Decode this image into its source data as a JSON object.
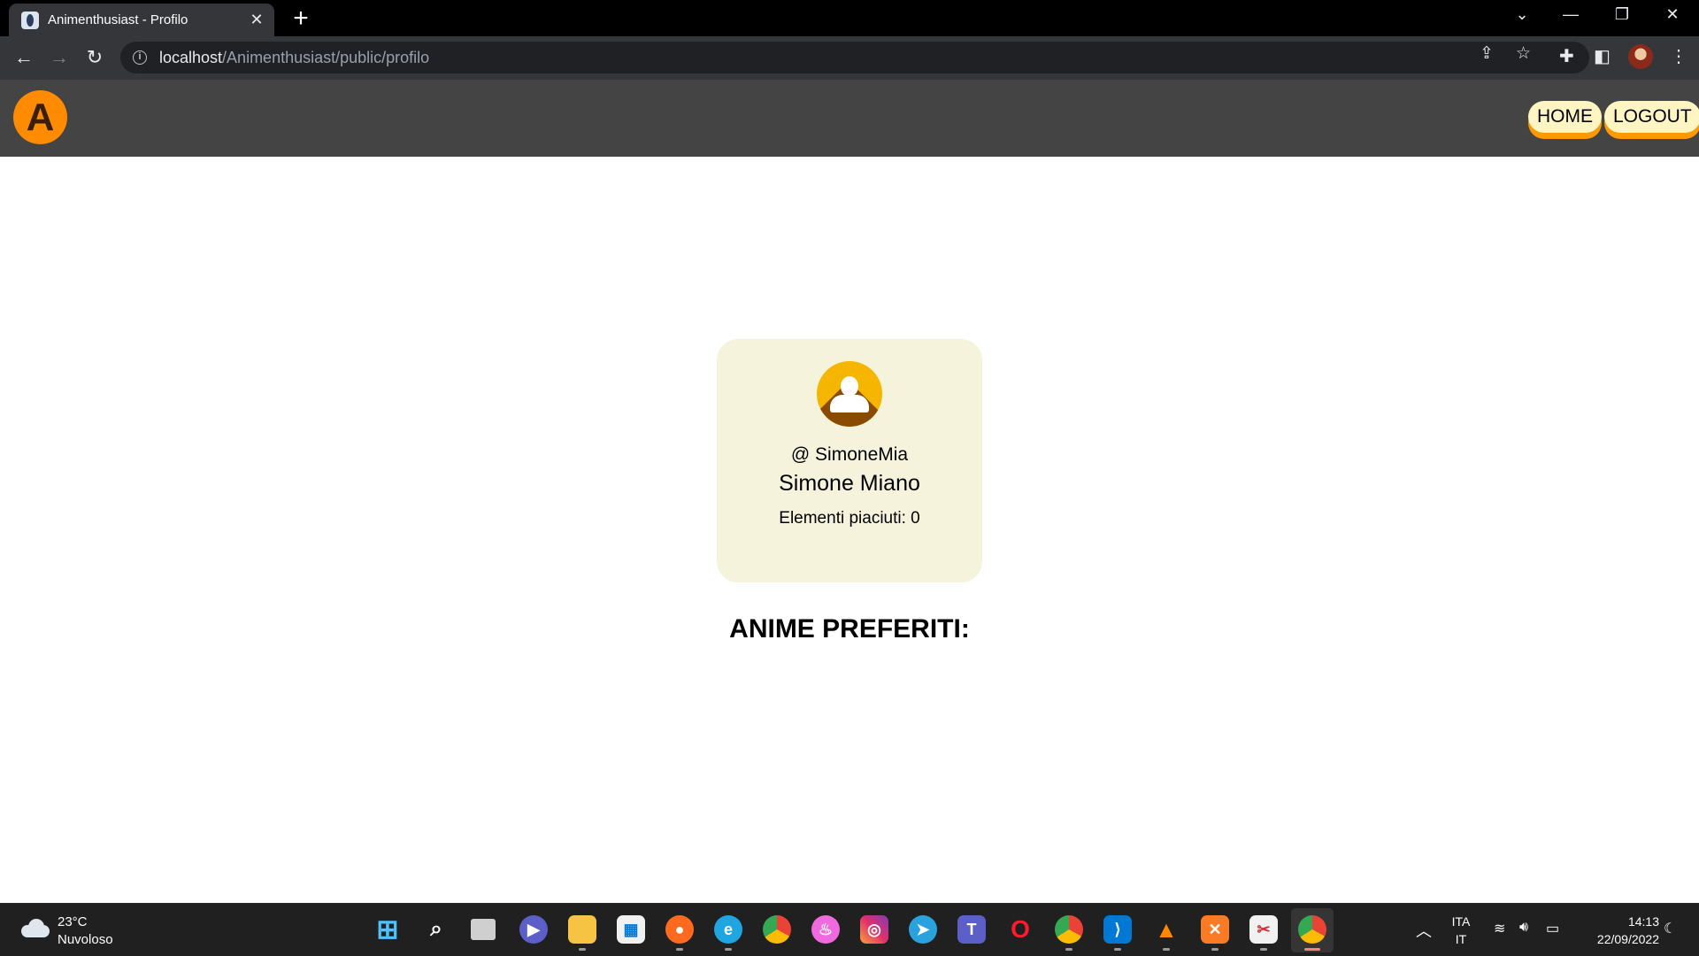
{
  "browser": {
    "tab_title": "Animenthusiast - Profilo",
    "tab_close": "✕",
    "new_tab": "+",
    "url_host": "localhost",
    "url_path": "/Animenthusiast/public/profilo"
  },
  "site": {
    "logo_letter": "A",
    "nav": {
      "home": "HOME",
      "logout": "LOGOUT"
    }
  },
  "profile": {
    "username": "@ SimoneMia",
    "full_name": "Simone Miano",
    "likes_text": "Elementi piaciuti: 0"
  },
  "section_title": "ANIME PREFERITI:",
  "taskbar": {
    "weather_temp": "23°C",
    "weather_desc": "Nuvoloso",
    "lang_primary": "ITA",
    "lang_secondary": "IT",
    "time": "14:13",
    "date": "22/09/2022"
  },
  "colors": {
    "header_bg": "#444444",
    "logo_bg": "#ff8c00",
    "nav_button_bg": "#fff5c2",
    "nav_button_shadow": "#ff9900",
    "card_bg": "#f5f3db",
    "avatar_bg": "#f5b500"
  }
}
